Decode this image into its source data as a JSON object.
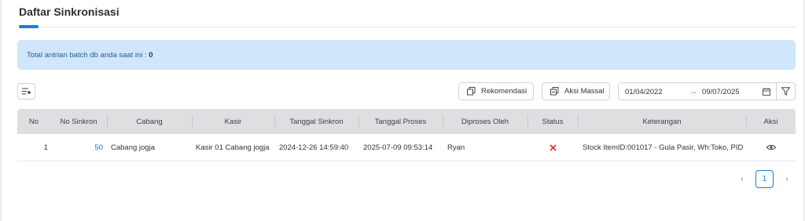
{
  "page": {
    "title": "Daftar Sinkronisasi"
  },
  "alert": {
    "text": "Total antrian batch db anda saat ini : ",
    "count": "0"
  },
  "toolbar": {
    "columns_icon": "column-settings-icon",
    "rekomendasi_label": "Rekomendasi",
    "aksi_massal_label": "Aksi Massal",
    "date_from": "01/04/2022",
    "date_to": "09/07/2025",
    "arrow": "→"
  },
  "table": {
    "headers": [
      "No",
      "No Sinkron",
      "Cabang",
      "Kasir",
      "Tanggal Sinkron",
      "Tanggal Proses",
      "Diproses Oleh",
      "Status",
      "Keterangan",
      "Aksi"
    ],
    "rows": [
      {
        "no": "1",
        "no_sinkron": "50",
        "cabang": "Cabang jogja",
        "kasir": "Kasir 01 Cabang jogja",
        "tanggal_sinkron": "2024-12-26 14:59:40",
        "tanggal_proses": "2025-07-09 09:53:14",
        "diproses_oleh": "Ryan",
        "status": "failed",
        "keterangan": "Stock ItemID:001017 - Gula Pasir, Wh:Toko, PID...",
        "aksi": "view-icon"
      }
    ]
  },
  "pagination": {
    "prev": "‹",
    "current": "1",
    "next": "›"
  },
  "colors": {
    "accent": "#1a7fd6",
    "alert_bg": "#cfe6fb",
    "status_failed": "#e0302a",
    "link": "#1a73c9"
  }
}
